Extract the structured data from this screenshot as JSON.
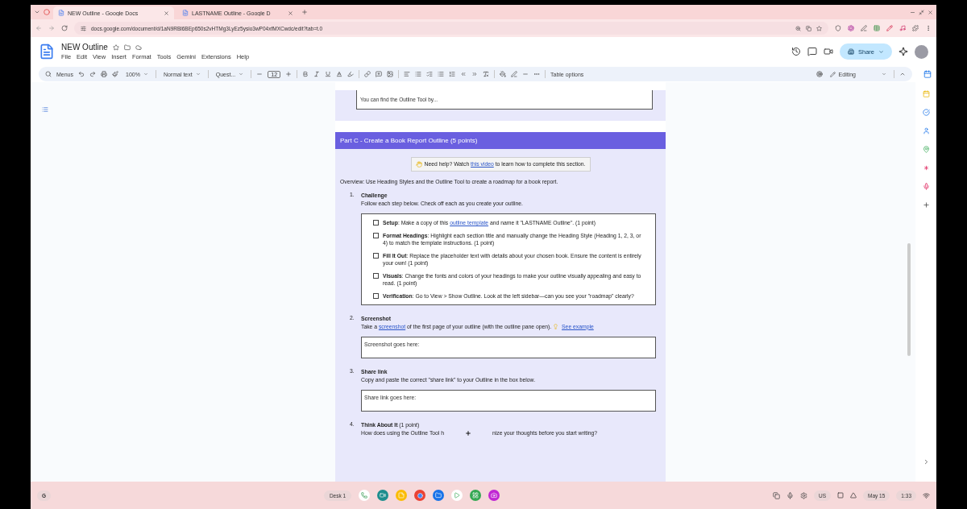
{
  "browser": {
    "tabs": [
      {
        "title": "NEW Outline - Google Docs",
        "selected": true
      },
      {
        "title": "LASTNAME Outline - Google D",
        "selected": false
      }
    ],
    "url": "docs.google.com/document/d/1aN9RBl6BEp650s2vHTMg3LyEz5ysio3wP04xfMXCwdc/edit?tab=t.0"
  },
  "docs": {
    "title": "NEW Outline",
    "menu": [
      "File",
      "Edit",
      "View",
      "Insert",
      "Format",
      "Tools",
      "Gemini",
      "Extensions",
      "Help"
    ],
    "share": "Share",
    "toolbar": {
      "search": "Menus",
      "zoom": "100%",
      "style": "Normal text",
      "font": "Quest...",
      "font_size": "12",
      "table_options": "Table options",
      "mode": "Editing"
    }
  },
  "document": {
    "previous_box_lines": [
      "You can find the Outline Tool by..."
    ],
    "section_title": "Part C - Create a Book Report Outline (5 points)",
    "help": [
      {
        "kind": "text",
        "text": "Need help? Watch "
      },
      {
        "kind": "link",
        "text": "this video"
      },
      {
        "kind": "text",
        "text": " to learn how to complete this section."
      }
    ],
    "overview": "Overview: Use Heading Styles and the Outline Tool to create a roadmap for a book report.",
    "steps": [
      {
        "number": "1.",
        "heading": [
          {
            "kind": "bold",
            "text": "Challenge"
          }
        ],
        "description": [
          {
            "kind": "text",
            "text": "Follow each step below. Check off each as you create your outline."
          }
        ],
        "checklist": [
          {
            "checked": false,
            "segments": [
              {
                "kind": "bold",
                "text": "Setup"
              },
              {
                "kind": "text",
                "text": ": Make a copy of this "
              },
              {
                "kind": "link",
                "text": "outline template"
              },
              {
                "kind": "text",
                "text": " and name it \"LASTNAME Outline\". (1 point)"
              }
            ]
          },
          {
            "checked": false,
            "segments": [
              {
                "kind": "bold",
                "text": "Format Headings"
              },
              {
                "kind": "text",
                "text": ": Highlight each section title and manually change the Heading Style (Heading 1, 2, 3, or 4) to match the template instructions. (1 point)"
              }
            ]
          },
          {
            "checked": false,
            "segments": [
              {
                "kind": "bold",
                "text": "Fill It Out"
              },
              {
                "kind": "text",
                "text": ": Replace the placeholder text with details about your chosen book. Ensure the content is entirely your own! (1 point)"
              }
            ]
          },
          {
            "checked": false,
            "segments": [
              {
                "kind": "bold",
                "text": "Visuals"
              },
              {
                "kind": "text",
                "text": ": Change the fonts and colors of your headings to make your outline visually appealing and easy to read. (1 point)"
              }
            ]
          },
          {
            "checked": false,
            "segments": [
              {
                "kind": "bold",
                "text": "Verification"
              },
              {
                "kind": "text",
                "text": ": Go to View > Show Outline. Look at the left sidebar—can you see your \"roadmap\" clearly?"
              }
            ]
          }
        ]
      },
      {
        "number": "2.",
        "heading": [
          {
            "kind": "bold",
            "text": "Screenshot"
          }
        ],
        "description": [
          {
            "kind": "text",
            "text": "Take a "
          },
          {
            "kind": "link",
            "text": "screenshot"
          },
          {
            "kind": "text",
            "text": " of the first page of your outline (with the outline pane open). "
          },
          {
            "kind": "bulb"
          },
          {
            "kind": "link",
            "text": "See example"
          }
        ],
        "answer_box": "Screenshot goes here:"
      },
      {
        "number": "3.",
        "heading": [
          {
            "kind": "bold",
            "text": "Share link"
          }
        ],
        "description": [
          {
            "kind": "text",
            "text": "Copy and paste the correct \"share link\" to your Outline in the box below."
          }
        ],
        "answer_box": "Share link goes here:"
      },
      {
        "number": "4.",
        "heading": [
          {
            "kind": "bold",
            "text": "Think About It"
          },
          {
            "kind": "text",
            "text": " (1 point)"
          }
        ],
        "description": [
          {
            "kind": "text",
            "text": "How does using the Outline Tool h"
          },
          {
            "kind": "cursor"
          },
          {
            "kind": "text",
            "text": "nize your thoughts before you start writing?"
          }
        ]
      }
    ]
  },
  "taskbar": {
    "launcher": "G",
    "desk": "Desk 1",
    "keyboard": "US",
    "date": "May 15",
    "time": "1:33"
  }
}
